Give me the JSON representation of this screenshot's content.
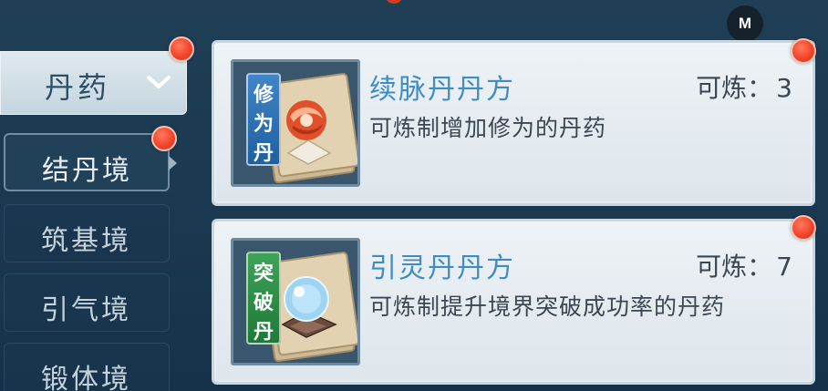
{
  "category": {
    "label": "丹药"
  },
  "realms": [
    {
      "label": "结丹境",
      "active": true
    },
    {
      "label": "筑基境",
      "active": false
    },
    {
      "label": "引气境",
      "active": false
    },
    {
      "label": "锻体境",
      "active": false
    }
  ],
  "badge": {
    "label": "M"
  },
  "recipes": [
    {
      "tag": [
        "修",
        "为",
        "丹"
      ],
      "tag_color": "#2f73b8",
      "title": "续脉丹丹方",
      "desc": "可炼制增加修为的丹药",
      "count_label": "可炼：",
      "count": "3",
      "icon": "scroll-red-pill-icon"
    },
    {
      "tag": [
        "突",
        "破",
        "丹"
      ],
      "tag_color": "#2e8f47",
      "title": "引灵丹丹方",
      "desc": "可炼制提升境界突破成功率的丹药",
      "count_label": "可炼：",
      "count": "7",
      "icon": "scroll-blue-orb-icon"
    }
  ],
  "colors": {
    "accent_title": "#3f8bc4",
    "notification": "#f2452b",
    "background": "#1f3f57"
  }
}
